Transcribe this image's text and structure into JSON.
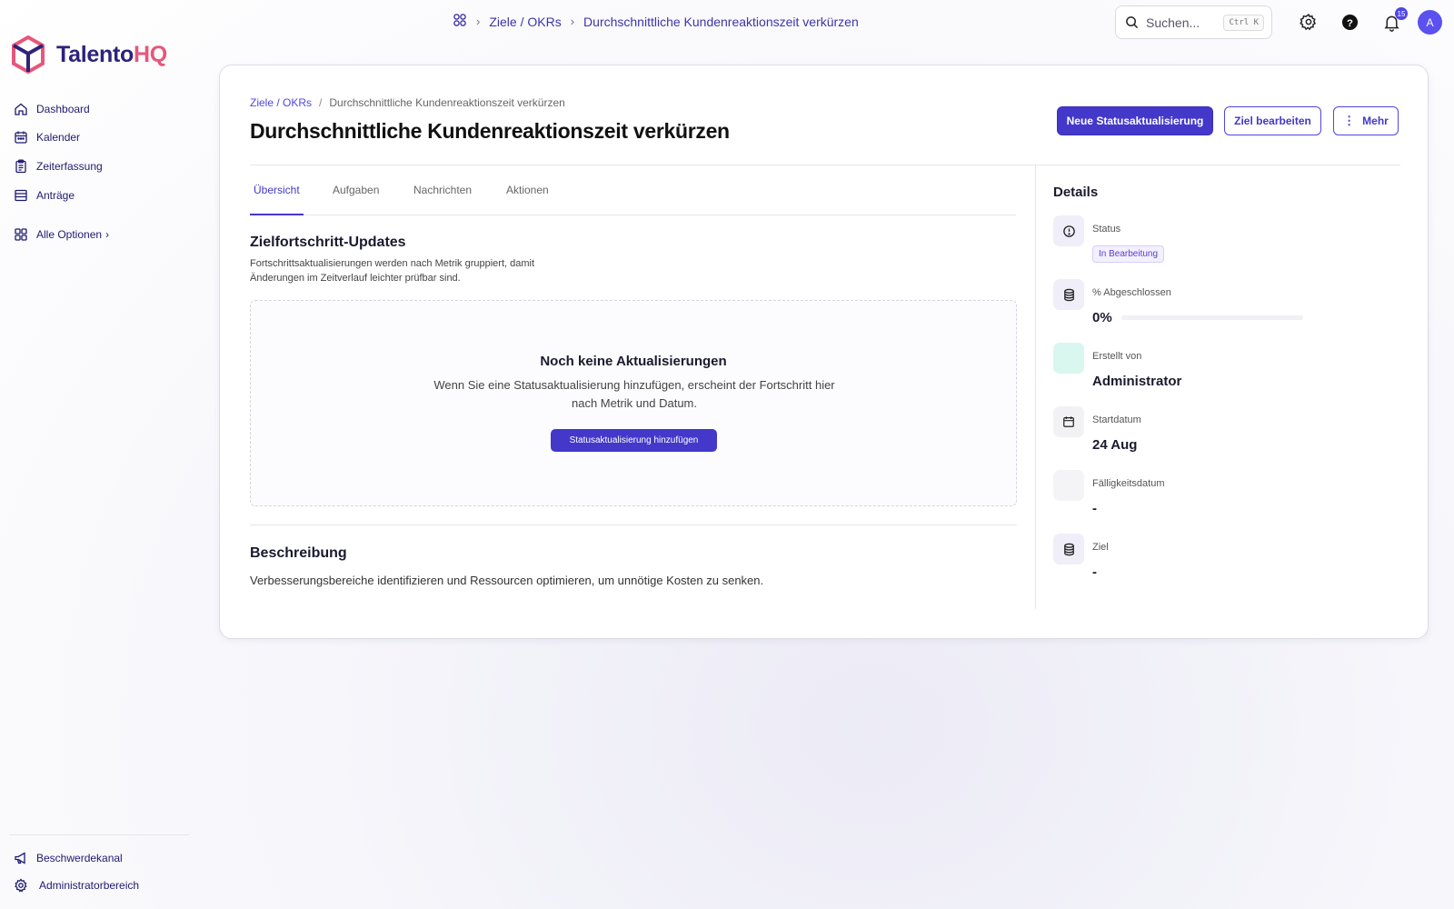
{
  "topbar": {
    "breadcrumb": [
      "Ziele / OKRs",
      "Durchschnittliche Kundenreaktionszeit verkürzen"
    ],
    "search_placeholder": "Suchen...",
    "search_shortcut": "Ctrl K",
    "notification_count": "15",
    "avatar_initial": "A"
  },
  "brand": {
    "part1": "Talento",
    "part2": "HQ",
    "accent": "#e8567a",
    "primary": "#2d237a"
  },
  "sidebar": {
    "items": [
      {
        "label": "Dashboard",
        "icon": "home-icon"
      },
      {
        "label": "Kalender",
        "icon": "calendar-icon"
      },
      {
        "label": "Zeiterfassung",
        "icon": "clipboard-icon"
      },
      {
        "label": "Anträge",
        "icon": "list-icon"
      }
    ],
    "all_options": "Alle Optionen",
    "bottom": [
      {
        "label": "Beschwerdekanal",
        "icon": "megaphone-icon"
      },
      {
        "label": "Administratorbereich",
        "icon": "gear-icon"
      }
    ]
  },
  "page": {
    "breadcrumb_link": "Ziele / OKRs",
    "breadcrumb_sep": "/",
    "breadcrumb_current": "Durchschnittliche Kundenreaktionszeit verkürzen",
    "title": "Durchschnittliche Kundenreaktionszeit verkürzen",
    "actions": {
      "new_update": "Neue Statusaktualisierung",
      "edit": "Ziel bearbeiten",
      "more": "Mehr"
    },
    "tabs": [
      "Übersicht",
      "Aufgaben",
      "Nachrichten",
      "Aktionen"
    ],
    "progress_section": {
      "title": "Zielfortschritt-Updates",
      "subtitle": "Fortschrittsaktualisierungen werden nach Metrik gruppiert, damit Änderungen im Zeitverlauf leichter prüfbar sind.",
      "empty_title": "Noch keine Aktualisierungen",
      "empty_text": "Wenn Sie eine Statusaktualisierung hinzufügen, erscheint der Fortschritt hier nach Metrik und Datum.",
      "empty_button": "Statusaktualisierung hinzufügen"
    },
    "description": {
      "title": "Beschreibung",
      "text": "Verbesserungsbereiche identifizieren und Ressourcen optimieren, um unnötige Kosten zu senken."
    }
  },
  "details": {
    "title": "Details",
    "status_label": "Status",
    "status_value": "In Bearbeitung",
    "completed_label": "% Abgeschlossen",
    "completed_value": "0%",
    "completed_fraction": 0,
    "created_by_label": "Erstellt von",
    "created_by_value": "Administrator",
    "start_label": "Startdatum",
    "start_value": "24 Aug",
    "due_label": "Fälligkeitsdatum",
    "due_value": "-",
    "target_label": "Ziel",
    "target_value": "-"
  }
}
